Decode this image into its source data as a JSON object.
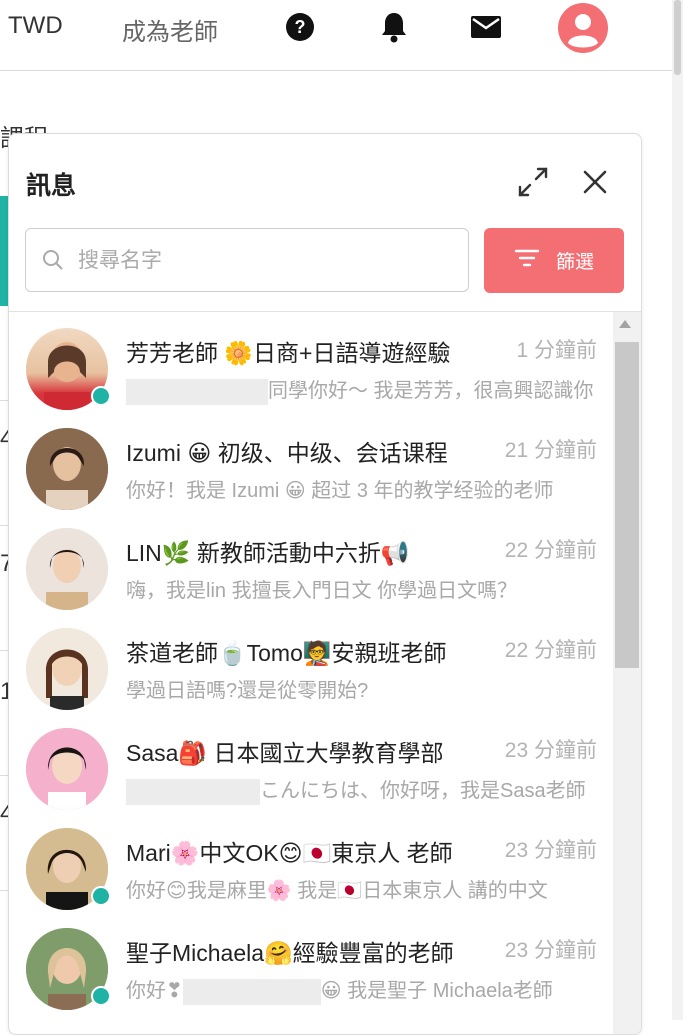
{
  "nav": {
    "brand": "TWD",
    "become_teacher": "成為老師",
    "icons": [
      "help-icon",
      "bell-icon",
      "mail-icon",
      "user-avatar-icon"
    ]
  },
  "background": {
    "fragments": [
      "課程",
      "4",
      "7",
      "1",
      "4"
    ]
  },
  "panel": {
    "title": "訊息",
    "search_placeholder": "搜尋名字",
    "filter_label": "篩選"
  },
  "conversations": [
    {
      "name": "芳芳老師 🌼日商+日語導遊經驗",
      "time": "1 分鐘前",
      "preview": "同學你好～ 我是芳芳，很高興認識你",
      "online": true,
      "redacted": true,
      "avatar_color": "#e7c2a0"
    },
    {
      "name": "Izumi 😀 初级、中级、会话课程",
      "time": "21 分鐘前",
      "preview": "你好！我是 Izumi 😀 超过 3 年的教学经验的老师",
      "online": false,
      "redacted": false,
      "avatar_color": "#8a6a4f"
    },
    {
      "name": "LIN🌿 新教師活動中六折📢",
      "time": "22 分鐘前",
      "preview": "嗨，我是lin 我擅長入門日文 你學過日文嗎？",
      "online": false,
      "redacted": false,
      "avatar_color": "#cfc2b7"
    },
    {
      "name": "茶道老師🍵Tomo🧑‍🏫安親班老師",
      "time": "22 分鐘前",
      "preview": "學過日語嗎?還是從零開始?",
      "online": false,
      "redacted": false,
      "avatar_color": "#d9c7b1"
    },
    {
      "name": "Sasa🎒 日本國立大學教育學部",
      "time": "23 分鐘前",
      "preview": "こんにちは、你好呀，我是Sasa老師",
      "online": false,
      "redacted": true,
      "avatar_color": "#f4a8c6"
    },
    {
      "name": "Mari🌸中文OK😊🇯🇵東京人 老師",
      "time": "23 分鐘前",
      "preview": "你好😊我是麻里🌸 我是🇯🇵日本東京人 講的中文",
      "online": true,
      "redacted": false,
      "avatar_color": "#cfb58c"
    },
    {
      "name": "聖子Michaela🤗經驗豐富的老師",
      "time": "23 分鐘前",
      "preview": "😀 我是聖子 Michaela老師",
      "preview_lead": "你好❣",
      "online": true,
      "redacted": true,
      "avatar_color": "#7d9a6a"
    }
  ],
  "colors": {
    "accent": "#f46f73",
    "online": "#1fb3a5",
    "teal": "#21b3a4"
  }
}
